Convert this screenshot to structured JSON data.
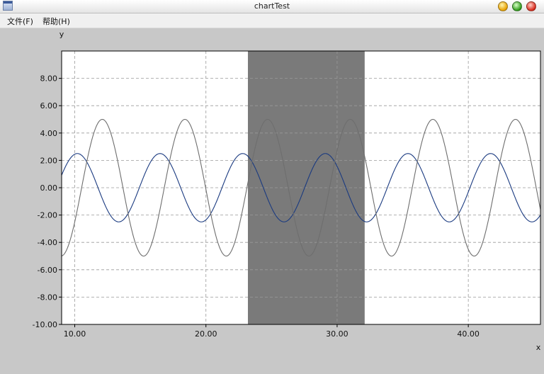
{
  "window": {
    "title": "chartTest"
  },
  "menu": {
    "items": [
      {
        "label": "文件(F)"
      },
      {
        "label": "帮助(H)"
      }
    ]
  },
  "colors": {
    "series_blue": "#1a3a80",
    "series_grey": "#6e6e6e",
    "band": "#7a7a7a"
  },
  "chart_data": {
    "type": "line",
    "xlabel": "x",
    "ylabel": "y",
    "xlim": [
      9.0,
      45.5
    ],
    "ylim": [
      -10,
      10
    ],
    "x_ticks": [
      10,
      20,
      30,
      40
    ],
    "x_tick_labels": [
      "10.00",
      "20.00",
      "30.00",
      "40.00"
    ],
    "y_ticks": [
      8,
      6,
      4,
      2,
      0,
      -2,
      -4,
      -6,
      -8,
      -10
    ],
    "y_tick_labels": [
      "8.00",
      "6.00",
      "4.00",
      "2.00",
      "0.00",
      "-2.00",
      "-4.00",
      "-6.00",
      "-8.00",
      "-10.00"
    ],
    "grid": true,
    "legend": "none",
    "highlight_band": {
      "x_start": 23.2,
      "x_end": 32.1
    },
    "series": [
      {
        "amplitude": 2.5,
        "period": 6.3,
        "phase_x": 10.2,
        "x_start": 9.0,
        "x_end": 45.5
      },
      {
        "amplitude": 5.0,
        "period": 6.3,
        "phase_x": 12.1,
        "x_start": 9.0,
        "x_end": 45.5
      }
    ]
  }
}
